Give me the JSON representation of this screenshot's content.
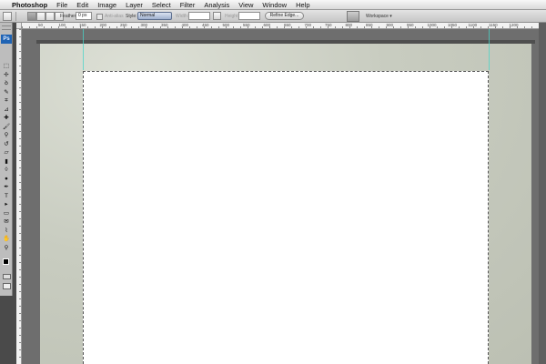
{
  "menubar": {
    "apple_glyph": "",
    "app_name": "Photoshop",
    "items": [
      "File",
      "Edit",
      "Image",
      "Layer",
      "Select",
      "Filter",
      "Analysis",
      "View",
      "Window",
      "Help"
    ]
  },
  "options": {
    "feather_label": "Feather:",
    "feather_value": "0 px",
    "antialias_label": "Anti-alias",
    "style_label": "Style:",
    "style_value": "Normal",
    "width_label": "Width:",
    "height_label": "Height:",
    "refine_edge_label": "Refine Edge...",
    "workspace_label": "Workspace ▾"
  },
  "toolbar": {
    "logo": "Ps",
    "tools": [
      {
        "name": "marquee-tool-icon",
        "glyph": "⬚"
      },
      {
        "name": "move-tool-icon",
        "glyph": "✢"
      },
      {
        "name": "lasso-tool-icon",
        "glyph": "ꝺ"
      },
      {
        "name": "quick-selection-tool-icon",
        "glyph": "✎"
      },
      {
        "name": "crop-tool-icon",
        "glyph": "⌗"
      },
      {
        "name": "slice-tool-icon",
        "glyph": "⊿"
      },
      {
        "name": "healing-brush-icon",
        "glyph": "✚"
      },
      {
        "name": "brush-tool-icon",
        "glyph": "🖌"
      },
      {
        "name": "clone-stamp-icon",
        "glyph": "⚲"
      },
      {
        "name": "history-brush-icon",
        "glyph": "↺"
      },
      {
        "name": "eraser-tool-icon",
        "glyph": "▱"
      },
      {
        "name": "gradient-tool-icon",
        "glyph": "▮"
      },
      {
        "name": "blur-tool-icon",
        "glyph": "◊"
      },
      {
        "name": "dodge-tool-icon",
        "glyph": "●"
      },
      {
        "name": "pen-tool-icon",
        "glyph": "✒"
      },
      {
        "name": "type-tool-icon",
        "glyph": "T"
      },
      {
        "name": "path-selection-icon",
        "glyph": "▸"
      },
      {
        "name": "shape-tool-icon",
        "glyph": "▭"
      },
      {
        "name": "notes-tool-icon",
        "glyph": "✉"
      },
      {
        "name": "eyedropper-tool-icon",
        "glyph": "⌇"
      },
      {
        "name": "hand-tool-icon",
        "glyph": "✋"
      },
      {
        "name": "zoom-tool-icon",
        "glyph": "⚲"
      }
    ]
  },
  "rulers": {
    "top_numbers": [
      "50",
      "100",
      "150",
      "200",
      "250",
      "300",
      "350",
      "400",
      "450",
      "500",
      "550",
      "600",
      "650",
      "700",
      "750",
      "800",
      "850",
      "900",
      "950",
      "1000",
      "1050",
      "1100",
      "1150",
      "1200"
    ]
  },
  "colors": {
    "ps_logo": "#1f63b4",
    "guide": "#48d6c8",
    "canvas_bg": "#c8ccc0"
  }
}
